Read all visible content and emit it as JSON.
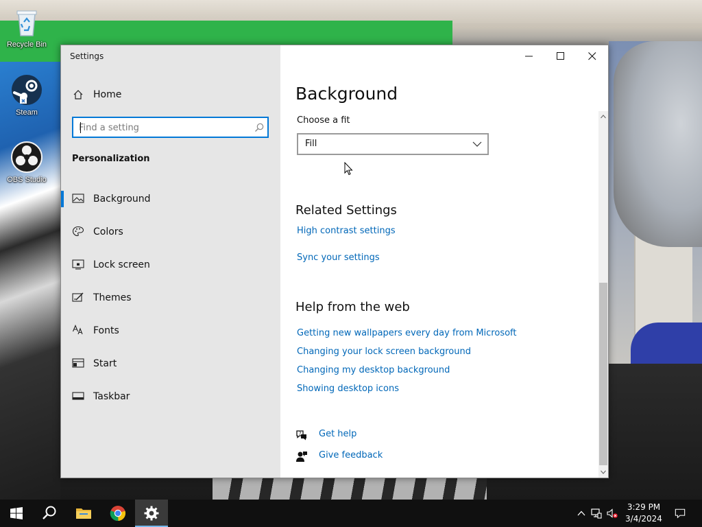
{
  "desktop": {
    "icons": [
      {
        "label": "Recycle Bin",
        "icon": "recycle-bin-icon"
      },
      {
        "label": "Steam",
        "icon": "steam-icon"
      },
      {
        "label": "OBS Studio",
        "icon": "obs-studio-icon"
      }
    ]
  },
  "window": {
    "title": "Settings",
    "controls": {
      "minimize": "minimize-icon",
      "maximize": "maximize-icon",
      "close": "close-icon"
    }
  },
  "sidebar": {
    "home_label": "Home",
    "search_placeholder": "Find a setting",
    "section_title": "Personalization",
    "items": [
      {
        "label": "Background",
        "icon": "picture-icon",
        "active": true
      },
      {
        "label": "Colors",
        "icon": "palette-icon",
        "active": false
      },
      {
        "label": "Lock screen",
        "icon": "lock-screen-icon",
        "active": false
      },
      {
        "label": "Themes",
        "icon": "themes-icon",
        "active": false
      },
      {
        "label": "Fonts",
        "icon": "fonts-icon",
        "active": false
      },
      {
        "label": "Start",
        "icon": "start-icon",
        "active": false
      },
      {
        "label": "Taskbar",
        "icon": "taskbar-icon",
        "active": false
      }
    ]
  },
  "main": {
    "title": "Background",
    "fit_label": "Choose a fit",
    "fit_value": "Fill",
    "related": {
      "heading": "Related Settings",
      "links": [
        "High contrast settings",
        "Sync your settings"
      ]
    },
    "help_web": {
      "heading": "Help from the web",
      "links": [
        "Getting new wallpapers every day from Microsoft",
        "Changing your lock screen background",
        "Changing my desktop background",
        "Showing desktop icons"
      ]
    },
    "get_help": "Get help",
    "give_feedback": "Give feedback"
  },
  "taskbar": {
    "apps": [
      "start-icon",
      "search-icon",
      "file-explorer-icon",
      "chrome-icon",
      "settings-gear-icon"
    ],
    "time": "3:29 PM",
    "date": "3/4/2024"
  },
  "colors": {
    "accent": "#0078d7",
    "link": "#0067b8",
    "sidebar": "#e6e6e6",
    "taskbar": "#101010"
  }
}
